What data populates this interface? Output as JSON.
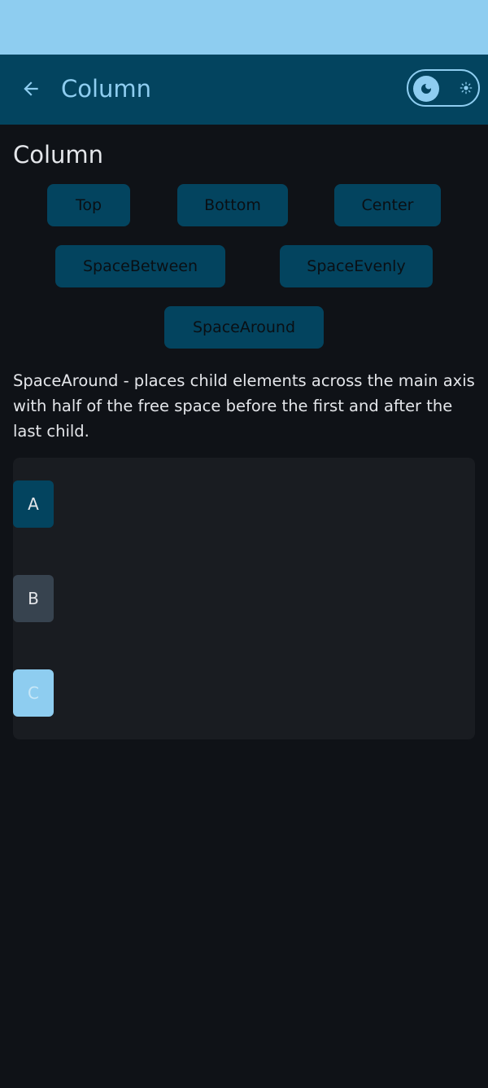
{
  "app_bar": {
    "title": "Column"
  },
  "theme_toggle": {
    "state": "dark"
  },
  "page": {
    "heading": "Column"
  },
  "arrangement_options": [
    {
      "label": "Top"
    },
    {
      "label": "Bottom"
    },
    {
      "label": "Center"
    },
    {
      "label": "SpaceBetween"
    },
    {
      "label": "SpaceEvenly"
    },
    {
      "label": "SpaceAround"
    }
  ],
  "description": "SpaceAround - places child elements across the main axis with half of the free space before the first and after the last child.",
  "demo": {
    "items": [
      {
        "label": "A"
      },
      {
        "label": "B"
      },
      {
        "label": "C"
      }
    ]
  },
  "colors": {
    "status_bar": "#8ecdf0",
    "app_bar": "#03445f",
    "accent": "#8ecdf0",
    "background": "#0f1217",
    "panel": "#191c21",
    "box_a": "#03445f",
    "box_b": "#37434f",
    "box_c": "#8ecdf0"
  },
  "icons": [
    "arrow-back-icon",
    "moon-icon",
    "sun-icon"
  ]
}
